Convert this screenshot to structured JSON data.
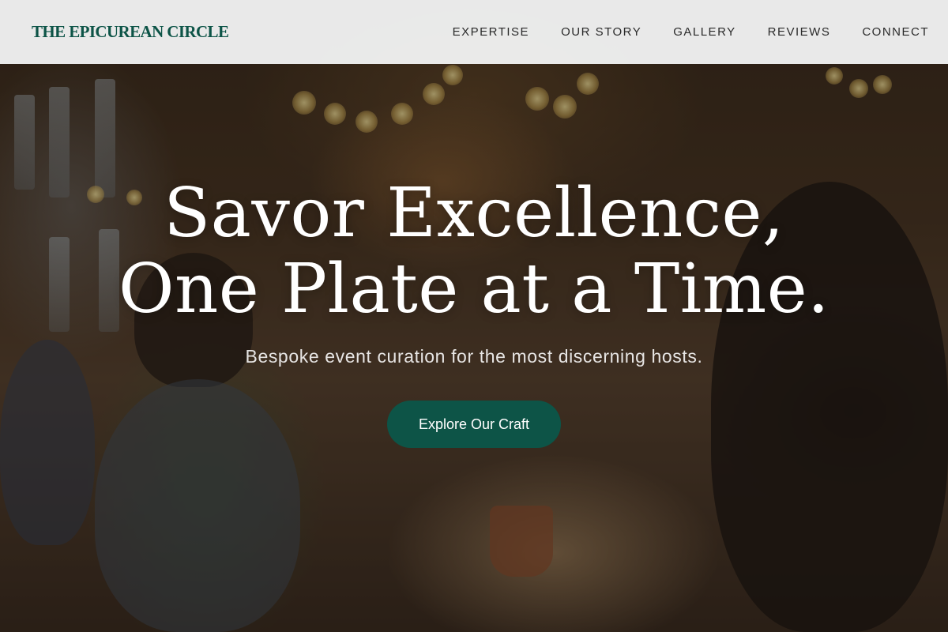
{
  "header": {
    "brand": "THE EPICUREAN CIRCLE",
    "nav": [
      {
        "label": "EXPERTISE"
      },
      {
        "label": "OUR STORY"
      },
      {
        "label": "GALLERY"
      },
      {
        "label": "REVIEWS"
      },
      {
        "label": "CONNECT"
      }
    ]
  },
  "hero": {
    "title_line_1": "Savor Excellence,",
    "title_line_2": "One Plate at a Time.",
    "subtitle": "Bespoke event curation for the most discerning hosts.",
    "cta_label": "Explore Our Craft"
  },
  "colors": {
    "brand_green": "#0d5447",
    "header_bg": "#f3f4f4",
    "hero_text": "#ffffff"
  }
}
